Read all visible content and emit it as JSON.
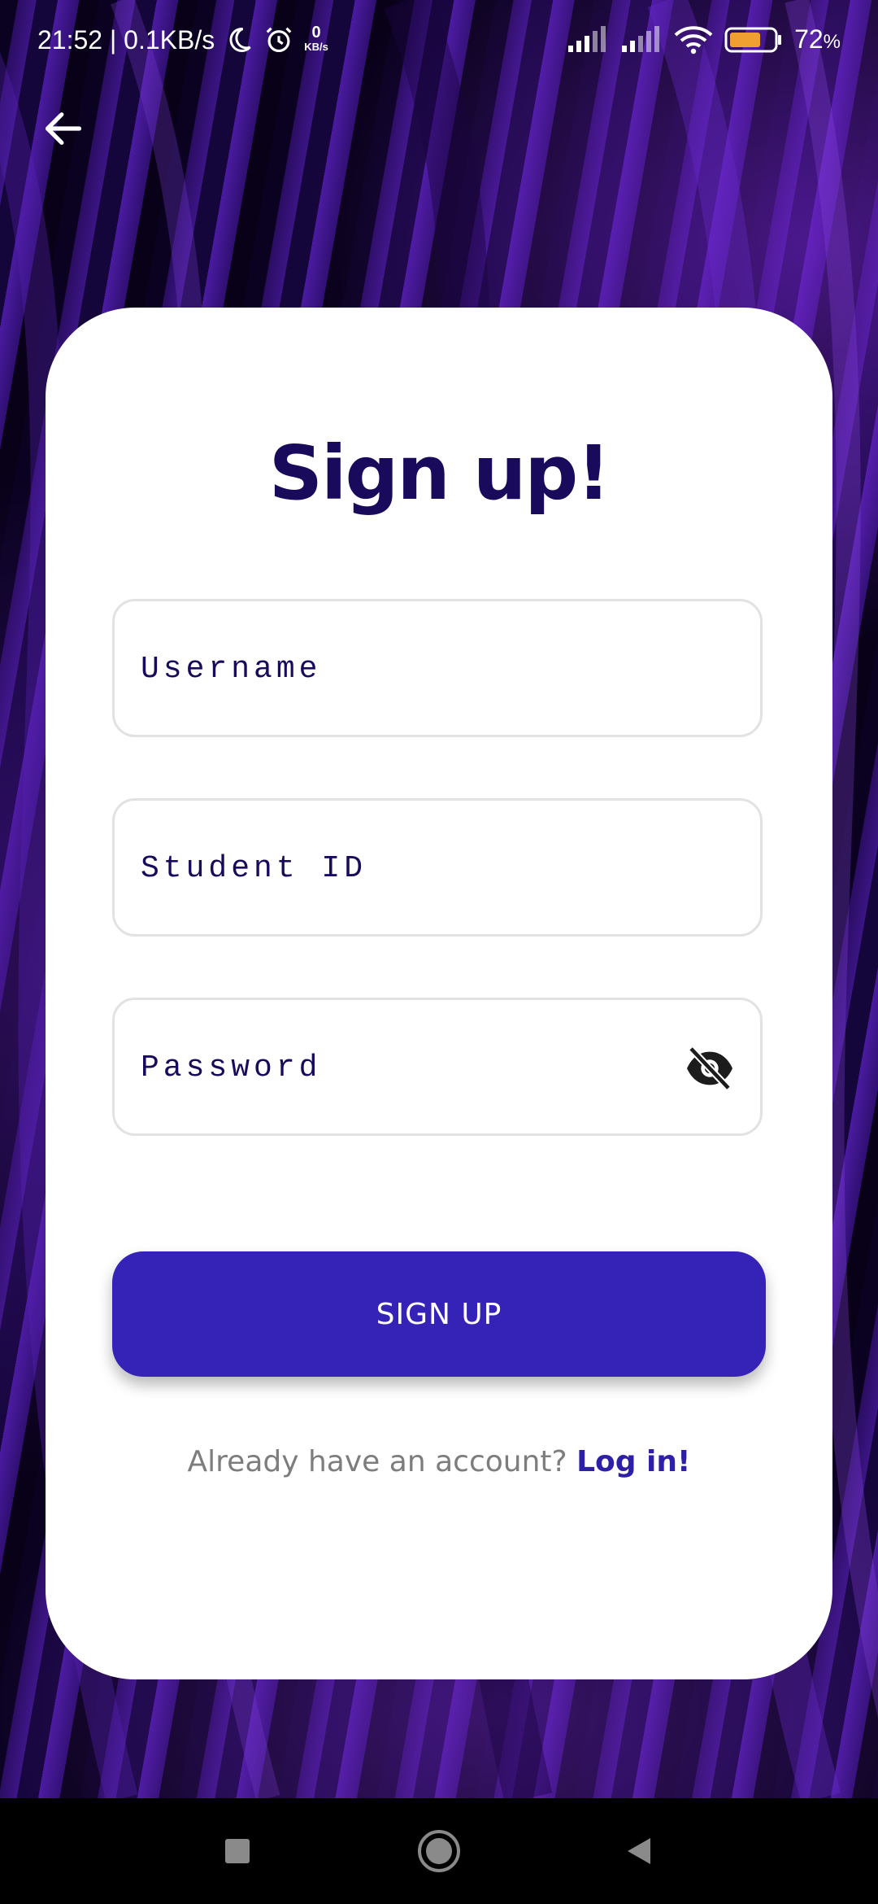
{
  "status_bar": {
    "time_speed": "21:52 | 0.1KB/s",
    "mini_speed_value": "0",
    "mini_speed_unit": "KB/s",
    "battery_percent_text": "72",
    "battery_percent_sign": "%",
    "battery_level": 0.72,
    "icons": [
      "moon-icon",
      "alarm-icon",
      "signal-icon",
      "signal-icon",
      "wifi-icon",
      "battery-icon"
    ]
  },
  "header": {
    "back_icon": "arrow-left-icon"
  },
  "form": {
    "title": "Sign up!",
    "username_placeholder": "Username",
    "student_id_placeholder": "Student ID",
    "password_placeholder": "Password",
    "password_toggle_icon": "eye-off-icon",
    "submit_label": "SIGN UP",
    "login_prompt": "Already have an account? ",
    "login_link": "Log in!"
  },
  "nav_bar": {
    "icons": [
      "square-icon",
      "circle-home-icon",
      "triangle-back-icon"
    ]
  },
  "colors": {
    "accent": "#3523b8",
    "title": "#1a0a5c",
    "background_purple": "#3b1585"
  }
}
